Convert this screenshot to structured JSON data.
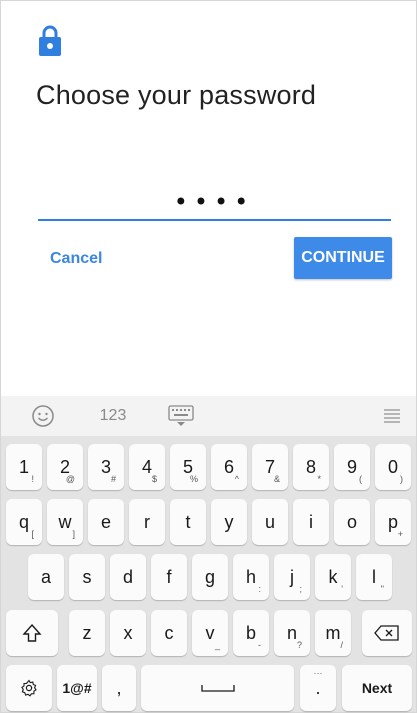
{
  "screen": {
    "title": "Choose your password",
    "password_mask": "••••",
    "cancel_label": "Cancel",
    "continue_label": "CONTINUE"
  },
  "colors": {
    "accent": "#3d8ae8",
    "link": "#3b86e0",
    "underline": "#2f7fe0"
  },
  "keyboard_toolbar": {
    "emoji_icon": "smiley-icon",
    "numbers_label": "123",
    "keyboard_icon": "keyboard-hide-icon",
    "menu_icon": "menu-lines-icon"
  },
  "keyboard": {
    "row1": [
      {
        "key": "1",
        "hint": "!"
      },
      {
        "key": "2",
        "hint": "@"
      },
      {
        "key": "3",
        "hint": "#"
      },
      {
        "key": "4",
        "hint": "$"
      },
      {
        "key": "5",
        "hint": "%"
      },
      {
        "key": "6",
        "hint": "^"
      },
      {
        "key": "7",
        "hint": "&"
      },
      {
        "key": "8",
        "hint": "*"
      },
      {
        "key": "9",
        "hint": "("
      },
      {
        "key": "0",
        "hint": ")"
      }
    ],
    "row2": [
      {
        "key": "q",
        "hint": "["
      },
      {
        "key": "w",
        "hint": "]"
      },
      {
        "key": "e",
        "hint": ""
      },
      {
        "key": "r",
        "hint": ""
      },
      {
        "key": "t",
        "hint": ""
      },
      {
        "key": "y",
        "hint": ""
      },
      {
        "key": "u",
        "hint": ""
      },
      {
        "key": "i",
        "hint": ""
      },
      {
        "key": "o",
        "hint": ""
      },
      {
        "key": "p",
        "hint": "+"
      }
    ],
    "row3": [
      {
        "key": "a",
        "hint": ""
      },
      {
        "key": "s",
        "hint": ""
      },
      {
        "key": "d",
        "hint": ""
      },
      {
        "key": "f",
        "hint": ""
      },
      {
        "key": "g",
        "hint": ""
      },
      {
        "key": "h",
        "hint": ":"
      },
      {
        "key": "j",
        "hint": ";"
      },
      {
        "key": "k",
        "hint": "'"
      },
      {
        "key": "l",
        "hint": "\""
      }
    ],
    "row4": [
      {
        "key": "z",
        "hint": ""
      },
      {
        "key": "x",
        "hint": ""
      },
      {
        "key": "c",
        "hint": ""
      },
      {
        "key": "v",
        "hint": "_"
      },
      {
        "key": "b",
        "hint": "-"
      },
      {
        "key": "n",
        "hint": "?"
      },
      {
        "key": "m",
        "hint": "/"
      }
    ],
    "symbols_label": "1@#",
    "comma_label": ",",
    "period_label": ".",
    "next_label": "Next"
  }
}
